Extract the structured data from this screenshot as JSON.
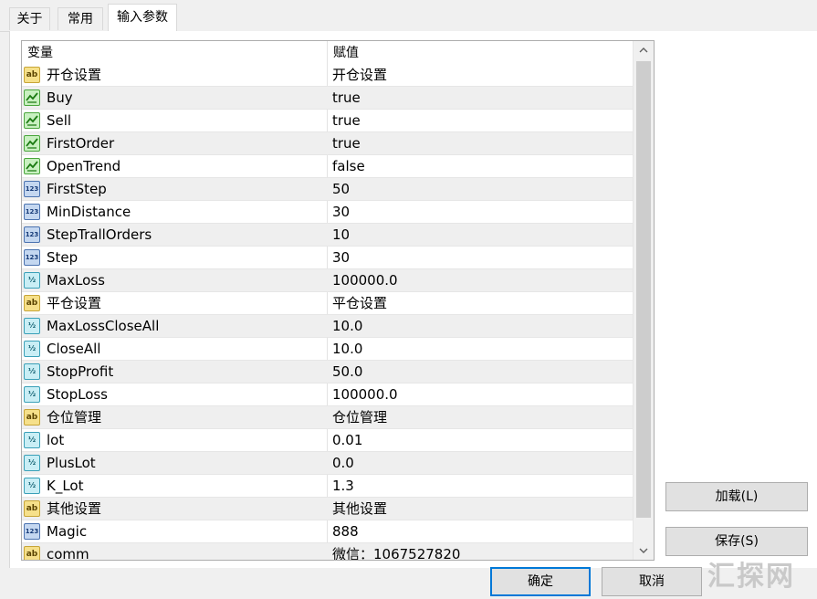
{
  "tabs": [
    {
      "label": "关于"
    },
    {
      "label": "常用"
    },
    {
      "label": "输入参数"
    }
  ],
  "grid": {
    "columns": {
      "variable": "变量",
      "value": "赋值"
    },
    "rows": [
      {
        "type": "string",
        "name": "开仓设置",
        "value": "开仓设置"
      },
      {
        "type": "bool",
        "name": "Buy",
        "value": "true"
      },
      {
        "type": "bool",
        "name": "Sell",
        "value": "true"
      },
      {
        "type": "bool",
        "name": "FirstOrder",
        "value": "true"
      },
      {
        "type": "bool",
        "name": "OpenTrend",
        "value": "false"
      },
      {
        "type": "int",
        "name": "FirstStep",
        "value": "50"
      },
      {
        "type": "int",
        "name": "MinDistance",
        "value": "30"
      },
      {
        "type": "int",
        "name": "StepTrallOrders",
        "value": "10"
      },
      {
        "type": "int",
        "name": "Step",
        "value": "30"
      },
      {
        "type": "double",
        "name": "MaxLoss",
        "value": "100000.0"
      },
      {
        "type": "string",
        "name": "平仓设置",
        "value": "平仓设置"
      },
      {
        "type": "double",
        "name": "MaxLossCloseAll",
        "value": "10.0"
      },
      {
        "type": "double",
        "name": "CloseAll",
        "value": "10.0"
      },
      {
        "type": "double",
        "name": "StopProfit",
        "value": "50.0"
      },
      {
        "type": "double",
        "name": "StopLoss",
        "value": "100000.0"
      },
      {
        "type": "string",
        "name": "仓位管理",
        "value": "仓位管理"
      },
      {
        "type": "double",
        "name": "lot",
        "value": "0.01"
      },
      {
        "type": "double",
        "name": "PlusLot",
        "value": "0.0"
      },
      {
        "type": "double",
        "name": "K_Lot",
        "value": "1.3"
      },
      {
        "type": "string",
        "name": "其他设置",
        "value": "其他设置"
      },
      {
        "type": "int",
        "name": "Magic",
        "value": "888"
      },
      {
        "type": "string",
        "name": "comm",
        "value": "微信：1067527820"
      }
    ]
  },
  "type_icons": {
    "string": {
      "glyph": "ab",
      "icon": "string-type-icon"
    },
    "bool": {
      "glyph": "",
      "icon": "bool-type-icon"
    },
    "int": {
      "glyph": "123",
      "icon": "integer-type-icon"
    },
    "double": {
      "glyph": "½",
      "icon": "double-type-icon"
    }
  },
  "buttons": {
    "load": "加载(L)",
    "save": "保存(S)",
    "ok": "确定",
    "cancel": "取消"
  },
  "watermark": "汇探网",
  "colors": {
    "focus_border": "#0078d7",
    "alt_row": "#efefef",
    "scroll_thumb": "#cdcdcd"
  }
}
